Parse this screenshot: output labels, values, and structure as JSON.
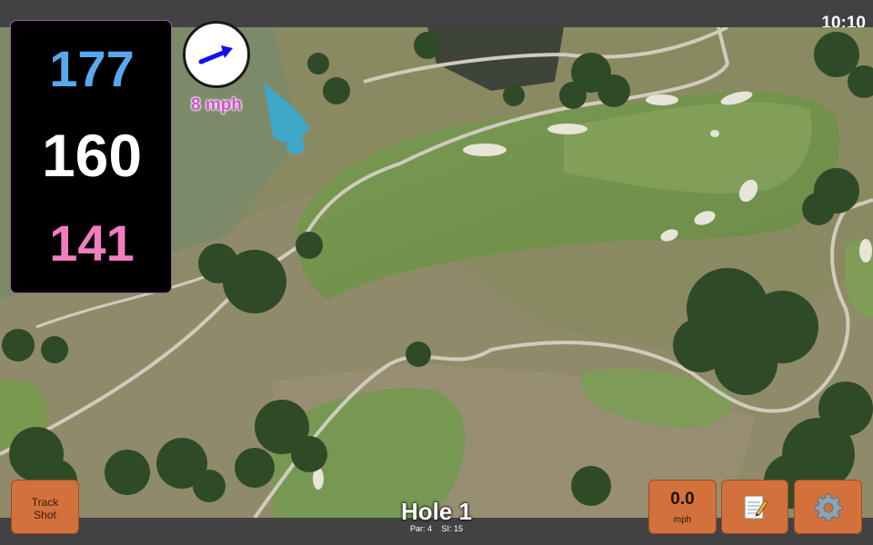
{
  "status": {
    "time": "10:10"
  },
  "distances": {
    "back": "177",
    "middle": "160",
    "front": "141"
  },
  "wind": {
    "speed": "8 mph",
    "icon": "wind-direction-arrow-icon"
  },
  "buttons": {
    "track_shot": {
      "line1": "Track",
      "line2": "Shot"
    },
    "speed": {
      "value": "0.0",
      "unit": "mph"
    },
    "notes": {
      "icon": "notepad-icon"
    },
    "settings": {
      "icon": "gear-icon"
    }
  },
  "hole": {
    "title": "Hole 1",
    "par": "Par: 4",
    "si": "SI: 15"
  },
  "colors": {
    "back": "#58a8f0",
    "middle": "#ffffff",
    "front": "#f07dbf",
    "wind_text": "#d24fd2",
    "button": "#d2713b",
    "arrow": "#1111ee"
  }
}
